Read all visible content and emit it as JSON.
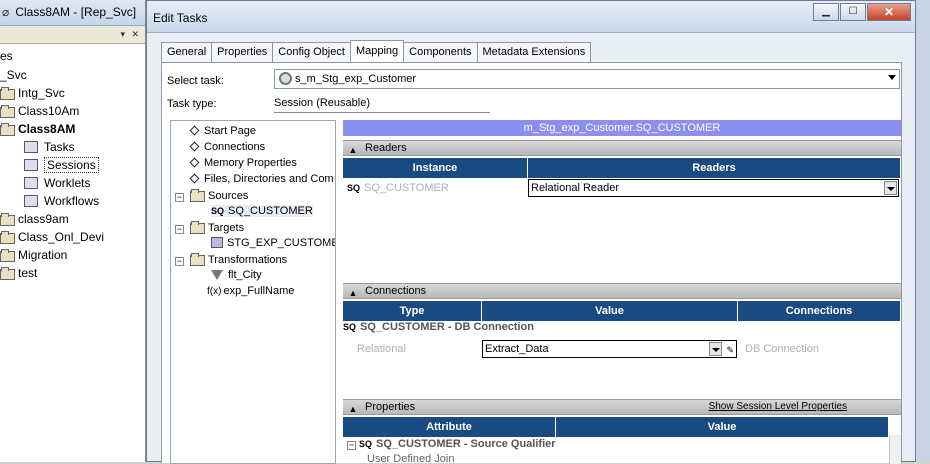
{
  "background_window": {
    "title": "Class8AM - [Rep_Svc]",
    "tree": [
      {
        "label": "es"
      },
      {
        "label": "_Svc"
      },
      {
        "label": "Intg_Svc"
      },
      {
        "label": "Class10Am"
      },
      {
        "label": "Class8AM"
      },
      {
        "label": "Tasks"
      },
      {
        "label": "Sessions"
      },
      {
        "label": "Worklets"
      },
      {
        "label": "Workflows"
      },
      {
        "label": "class9am"
      },
      {
        "label": "Class_Onl_Devi"
      },
      {
        "label": "Migration"
      },
      {
        "label": "test"
      }
    ]
  },
  "dialog": {
    "title": "Edit Tasks",
    "tabs": [
      "General",
      "Properties",
      "Config Object",
      "Mapping",
      "Components",
      "Metadata Extensions"
    ],
    "active_tab": "Mapping",
    "select_task_label": "Select task:",
    "select_task_value": "s_m_Stg_exp_Customer",
    "task_type_label": "Task type:",
    "task_type_value": "Session (Reusable)",
    "nav": {
      "start_page": "Start Page",
      "connections": "Connections",
      "memory_properties": "Memory Properties",
      "files": "Files, Directories and Com",
      "sources": "Sources",
      "sq_customer": "SQ_CUSTOMER",
      "targets": "Targets",
      "stg_target": "STG_EXP_CUSTOMER",
      "transformations": "Transformations",
      "flt_city": "flt_City",
      "exp_fullname": "exp_FullName"
    },
    "mapping_header": "m_Stg_exp_Customer.SQ_CUSTOMER",
    "readers": {
      "title": "Readers",
      "columns": [
        "Instance",
        "Readers"
      ],
      "row": {
        "instance": "SQ_CUSTOMER",
        "reader": "Relational Reader"
      }
    },
    "connections": {
      "title": "Connections",
      "columns": [
        "Type",
        "Value",
        "Connections"
      ],
      "subhead": "SQ_CUSTOMER - DB Connection",
      "row": {
        "type": "Relational",
        "value": "Extract_Data",
        "connection": "DB Connection"
      }
    },
    "properties": {
      "title": "Properties",
      "link": "Show Session Level Properties",
      "columns": [
        "Attribute",
        "Value"
      ],
      "subhead": "SQ_CUSTOMER - Source Qualifier",
      "first_attr": "User Defined Join"
    }
  }
}
